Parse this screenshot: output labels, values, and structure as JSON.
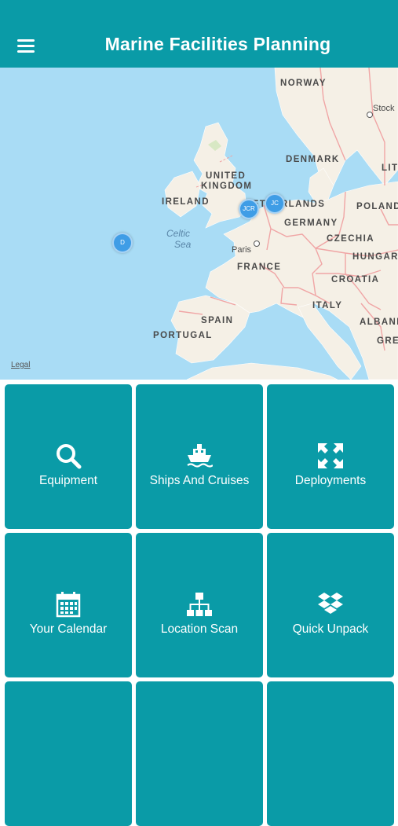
{
  "app": {
    "title": "Marine Facilities Planning",
    "menu_icon": "hamburger-menu-icon",
    "accent_color": "#0a9ba7"
  },
  "map": {
    "countries": [
      "NORWAY",
      "DENMARK",
      "UNITED",
      "KINGDOM",
      "IRELAND",
      "NETHERLANDS",
      "POLAND",
      "GERMANY",
      "CZECHIA",
      "HUNGARY",
      "FRANCE",
      "CROATIA",
      "ITALY",
      "SPAIN",
      "PORTUGAL",
      "ALBANIA",
      "GREECE",
      "LIT"
    ],
    "seas": [
      "Celtic",
      "Sea"
    ],
    "cities": [
      "Paris",
      "Stock"
    ],
    "markers": [
      "D",
      "JCR",
      "JC"
    ],
    "legal": "Legal"
  },
  "tiles": [
    {
      "label": "Equipment",
      "icon": "search-icon"
    },
    {
      "label": "Ships And Cruises",
      "icon": "ship-icon"
    },
    {
      "label": "Deployments",
      "icon": "expand-arrows-icon"
    },
    {
      "label": "Your Calendar",
      "icon": "calendar-icon"
    },
    {
      "label": "Location Scan",
      "icon": "sitemap-icon"
    },
    {
      "label": "Quick Unpack",
      "icon": "dropbox-icon"
    },
    {
      "label": "",
      "icon": ""
    },
    {
      "label": "",
      "icon": ""
    },
    {
      "label": "",
      "icon": ""
    }
  ]
}
